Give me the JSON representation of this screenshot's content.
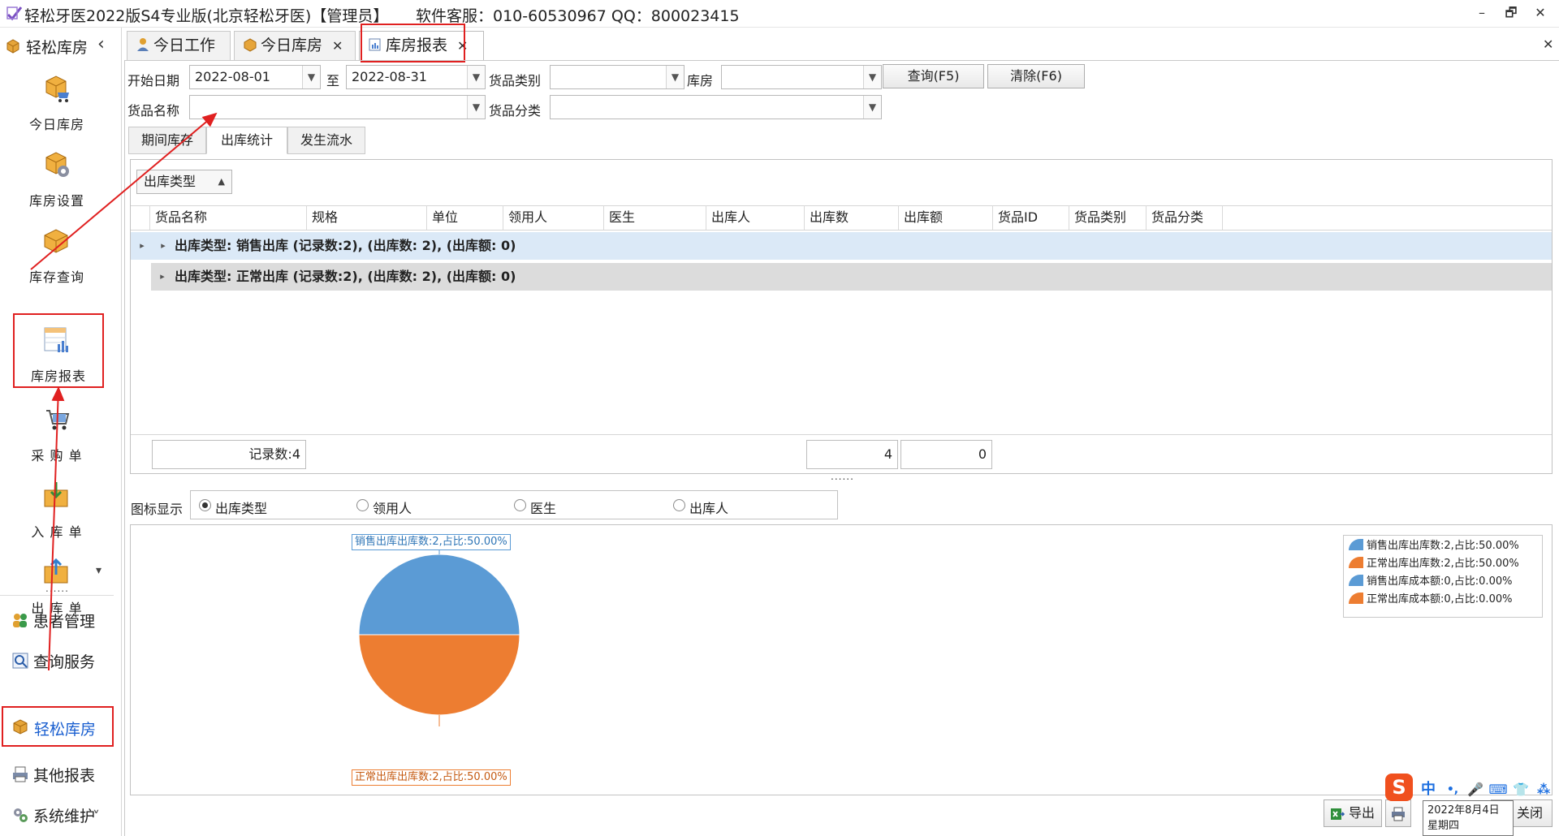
{
  "window": {
    "title": "轻松牙医2022版S4专业版(北京轻松牙医)【管理员】",
    "service": "软件客服：010-60530967 QQ：800023415",
    "min": "–",
    "restore": "🗗",
    "close": "✕"
  },
  "sidebar": {
    "header": "轻松库房",
    "collapse": "‹",
    "items": [
      {
        "label": "今日库房",
        "icon": "cart-box-icon"
      },
      {
        "label": "库房设置",
        "icon": "gear-box-icon"
      },
      {
        "label": "库存查询",
        "icon": "box-icon"
      },
      {
        "label": "库房报表",
        "icon": "report-icon"
      },
      {
        "label": "采 购 单",
        "icon": "shopping-cart-icon"
      },
      {
        "label": "入 库 单",
        "icon": "inbound-icon"
      },
      {
        "label": "出 库 单",
        "icon": "outbound-icon"
      }
    ],
    "more": "▾",
    "dots": "......",
    "nav": [
      {
        "label": "患者管理"
      },
      {
        "label": "查询服务"
      },
      {
        "label": "轻松库房"
      },
      {
        "label": "其他报表"
      },
      {
        "label": "系统维护"
      }
    ],
    "expand": "˅"
  },
  "tabs": [
    {
      "label": "今日工作"
    },
    {
      "label": "今日库房"
    },
    {
      "label": "库房报表"
    }
  ],
  "close_all": "✕",
  "form": {
    "start_label": "开始日期",
    "start_value": "2022-08-01",
    "to_label": "至",
    "end_value": "2022-08-31",
    "category_label": "货品类别",
    "category_value": "",
    "warehouse_label": "库房",
    "warehouse_value": "",
    "query_btn": "查询(F5)",
    "clear_btn": "清除(F6)",
    "name_label": "货品名称",
    "name_value": "",
    "class_label": "货品分类",
    "class_value": ""
  },
  "inner_tabs": [
    "期间库存",
    "出库统计",
    "发生流水"
  ],
  "group_chip": "出库类型",
  "columns": [
    "货品名称",
    "规格",
    "单位",
    "领用人",
    "医生",
    "出库人",
    "出库数",
    "出库额",
    "货品ID",
    "货品类别",
    "货品分类"
  ],
  "groups": [
    "出库类型: 销售出库 (记录数:2), (出库数: 2), (出库额: 0)",
    "出库类型: 正常出库 (记录数:2), (出库数: 2), (出库额: 0)"
  ],
  "summary": {
    "records": "记录数:4",
    "qty": "4",
    "amount": "0"
  },
  "splitter": "......",
  "chart_options": {
    "label": "图标显示",
    "options": [
      "出库类型",
      "领用人",
      "医生",
      "出库人"
    ],
    "selected": 0
  },
  "chart_data": {
    "type": "pie",
    "slices": [
      {
        "label": "销售出库出库数:2,占比:50.00%",
        "value": 2,
        "color": "#5b9bd5"
      },
      {
        "label": "正常出库出库数:2,占比:50.00%",
        "value": 2,
        "color": "#ed7d31"
      }
    ],
    "legend": [
      {
        "label": "销售出库出库数:2,占比:50.00%",
        "color": "#5b9bd5"
      },
      {
        "label": "正常出库出库数:2,占比:50.00%",
        "color": "#ed7d31"
      },
      {
        "label": "销售出库成本额:0,占比:0.00%",
        "color": "#5b9bd5"
      },
      {
        "label": "正常出库成本额:0,占比:0.00%",
        "color": "#ed7d31"
      }
    ],
    "legend_position": "top-right"
  },
  "footer": {
    "export": "导出",
    "close": "关闭"
  },
  "ime": {
    "logo": "S",
    "items": [
      "中",
      "•,",
      "🎤",
      "⌨",
      "👕",
      "⁂"
    ]
  },
  "tooltip": {
    "date": "2022年8月4日",
    "weekday": "星期四"
  }
}
